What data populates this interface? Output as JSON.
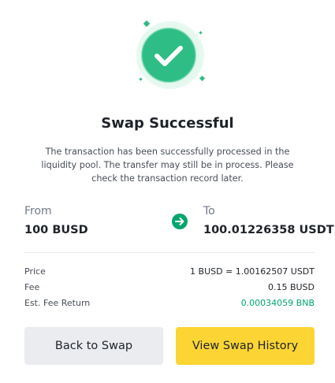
{
  "dialog": {
    "title": "Swap Successful",
    "description": "The transaction has been successfully processed in the liquidity pool. The transfer may still be in process. Please check the transaction record later.",
    "status_icon": "check-icon"
  },
  "swap": {
    "from_label": "From",
    "from_amount": "100 BUSD",
    "to_label": "To",
    "to_amount": "100.01226358 USDT",
    "direction_icon": "arrow-right-icon"
  },
  "details": {
    "price_label": "Price",
    "price_value": "1 BUSD = 1.00162507 USDT",
    "fee_label": "Fee",
    "fee_value": "0.15 BUSD",
    "return_label": "Est. Fee Return",
    "return_value": "0.00034059 BNB"
  },
  "actions": {
    "back_label": "Back to Swap",
    "history_label": "View Swap History"
  },
  "colors": {
    "success_green": "#03a66d",
    "primary_yellow": "#fcd535",
    "secondary_gray": "#eaecef",
    "text_dark": "#1e2329"
  }
}
